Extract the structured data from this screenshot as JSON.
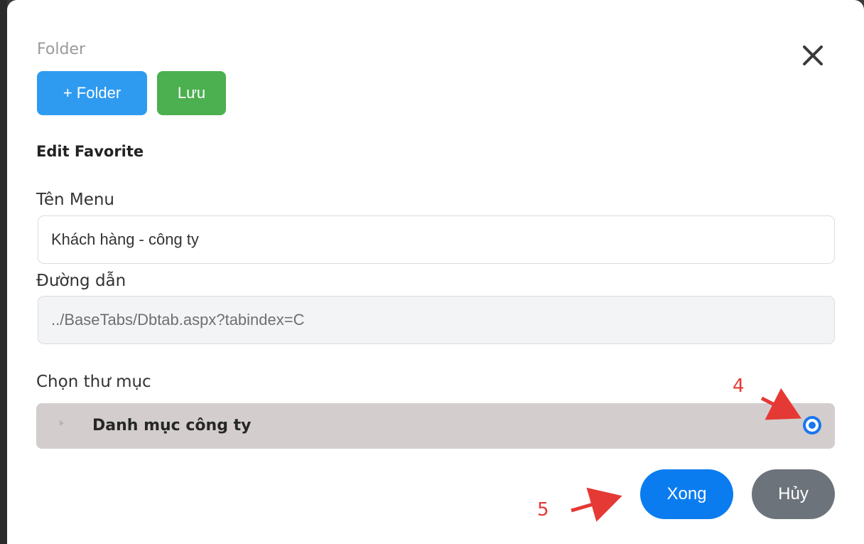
{
  "modal": {
    "folder_label": "Folder",
    "add_folder_label": "+ Folder",
    "save_label": "Lưu",
    "section_title": "Edit Favorite",
    "close_icon": "close-icon"
  },
  "form": {
    "menu_name_label": "Tên Menu",
    "menu_name_value": "Khách hàng - công ty",
    "path_label": "Đường dẫn",
    "path_value": "../BaseTabs/Dbtab.aspx?tabindex=C",
    "choose_folder_label": "Chọn thư mục"
  },
  "folders": [
    {
      "name": "Danh mục công ty",
      "selected": true
    }
  ],
  "footer": {
    "done_label": "Xong",
    "cancel_label": "Hủy"
  },
  "annotations": {
    "step_4": "4",
    "step_5": "5",
    "color": "#e53935"
  },
  "colors": {
    "primary": "#2e9bf0",
    "success": "#4caf50",
    "done": "#0a7cf0",
    "secondary": "#6c737b",
    "selected_row": "#d3cdcd"
  }
}
